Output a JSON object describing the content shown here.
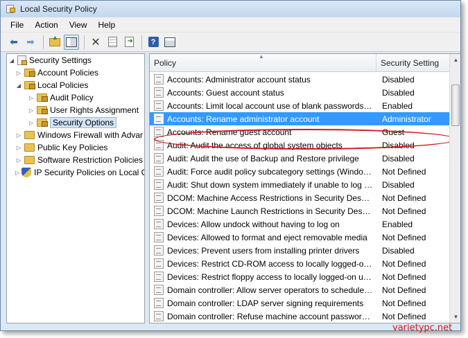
{
  "window": {
    "title": "Local Security Policy"
  },
  "menu": [
    "File",
    "Action",
    "View",
    "Help"
  ],
  "toolbar": {
    "buttons": [
      "back-icon",
      "forward-icon",
      "up-folder-icon",
      "show-hide-tree-icon",
      "delete-icon",
      "properties-icon",
      "export-list-icon",
      "help-icon",
      "mmc-panel-icon"
    ]
  },
  "tree": {
    "items": [
      {
        "label": "Security Settings",
        "expanded": true
      },
      {
        "label": "Account Policies",
        "expanded": false
      },
      {
        "label": "Local Policies",
        "expanded": true
      },
      {
        "label": "Audit Policy",
        "expanded": false
      },
      {
        "label": "User Rights Assignment",
        "expanded": false
      },
      {
        "label": "Security Options",
        "selected": true
      },
      {
        "label": "Windows Firewall with Advar",
        "expanded": false
      },
      {
        "label": "Public Key Policies",
        "expanded": false
      },
      {
        "label": "Software Restriction Policies",
        "expanded": false
      },
      {
        "label": "IP Security Policies on Local C",
        "expanded": false
      }
    ]
  },
  "list": {
    "columns": [
      "Policy",
      "Security Setting"
    ],
    "rows": [
      {
        "policy": "Accounts: Administrator account status",
        "setting": "Disabled"
      },
      {
        "policy": "Accounts: Guest account status",
        "setting": "Disabled"
      },
      {
        "policy": "Accounts: Limit local account use of blank passwords to...",
        "setting": "Enabled"
      },
      {
        "policy": "Accounts: Rename administrator account",
        "setting": "Administrator",
        "selected": true
      },
      {
        "policy": "Accounts: Rename guest account",
        "setting": "Guest"
      },
      {
        "policy": "Audit: Audit the access of global system objects",
        "setting": "Disabled"
      },
      {
        "policy": "Audit: Audit the use of Backup and Restore privilege",
        "setting": "Disabled"
      },
      {
        "policy": "Audit: Force audit policy subcategory settings (Window...",
        "setting": "Not Defined"
      },
      {
        "policy": "Audit: Shut down system immediately if unable to log s...",
        "setting": "Disabled"
      },
      {
        "policy": "DCOM: Machine Access Restrictions in Security Descript...",
        "setting": "Not Defined"
      },
      {
        "policy": "DCOM: Machine Launch Restrictions in Security Descrip...",
        "setting": "Not Defined"
      },
      {
        "policy": "Devices: Allow undock without having to log on",
        "setting": "Enabled"
      },
      {
        "policy": "Devices: Allowed to format and eject removable media",
        "setting": "Not Defined"
      },
      {
        "policy": "Devices: Prevent users from installing printer drivers",
        "setting": "Disabled"
      },
      {
        "policy": "Devices: Restrict CD-ROM access to locally logged-on u...",
        "setting": "Not Defined"
      },
      {
        "policy": "Devices: Restrict floppy access to locally logged-on user...",
        "setting": "Not Defined"
      },
      {
        "policy": "Domain controller: Allow server operators to schedule ta...",
        "setting": "Not Defined"
      },
      {
        "policy": "Domain controller: LDAP server signing requirements",
        "setting": "Not Defined"
      },
      {
        "policy": "Domain controller: Refuse machine account password c...",
        "setting": "Not Defined"
      }
    ]
  },
  "annotation": {
    "ring_color": "#d4161c"
  },
  "watermark": "varietypc.net",
  "colors": {
    "selection": "#3399ff",
    "accent_red": "#d4161c"
  }
}
